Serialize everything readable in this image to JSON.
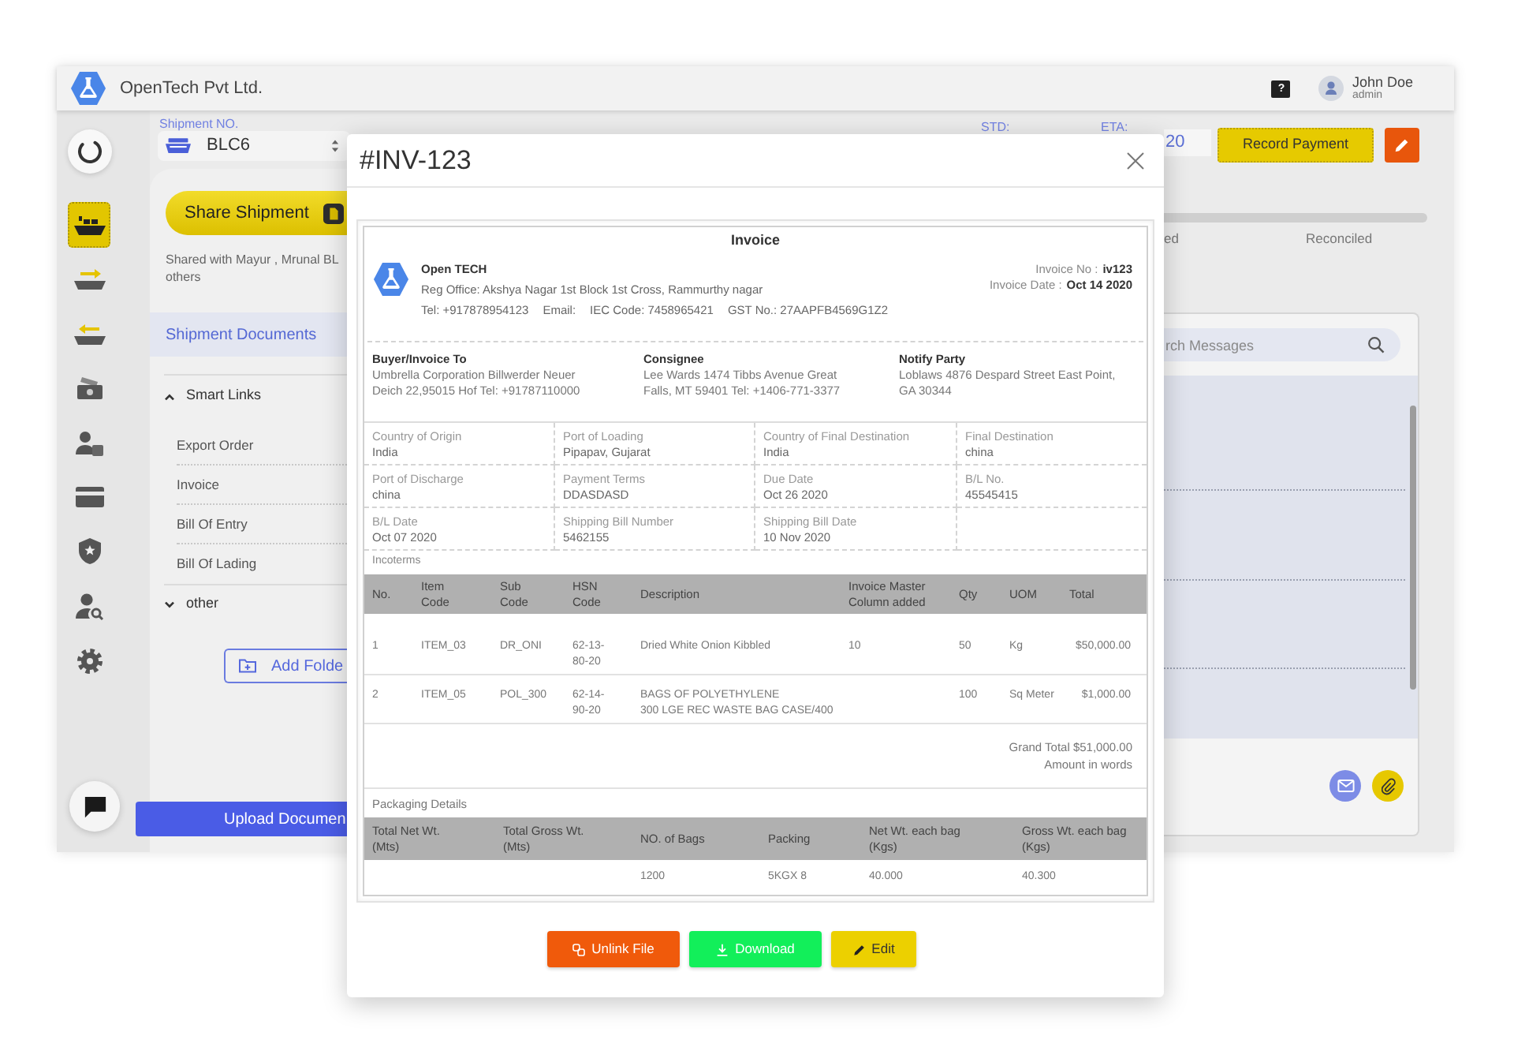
{
  "header": {
    "company": "OpenTech Pvt Ltd.",
    "help": "?",
    "user": {
      "name": "John Doe",
      "role": "admin"
    }
  },
  "sidebar": {
    "items": [
      {
        "kind": "ship",
        "selected": true
      },
      {
        "kind": "ship-export",
        "selected": false
      },
      {
        "kind": "ship-import",
        "selected": false
      },
      {
        "kind": "money",
        "selected": false
      },
      {
        "kind": "user-document",
        "selected": false
      },
      {
        "kind": "card",
        "selected": false
      },
      {
        "kind": "shield",
        "selected": false
      },
      {
        "kind": "user-search",
        "selected": false
      },
      {
        "kind": "settings",
        "selected": false
      }
    ]
  },
  "toolbar": {
    "shipment_label": "Shipment NO.",
    "shipment_value": "BLC6",
    "std_label": "STD:",
    "eta_label": "ETA:",
    "eta_value": "20",
    "record_payment": "Record Payment"
  },
  "share": {
    "button": "Share Shipment",
    "shared_with": [
      "Shared with Mayur , Mrunal BL",
      "others"
    ]
  },
  "progress": {
    "stages": [
      "ed",
      "Reconciled"
    ]
  },
  "documents": {
    "title": "Shipment Documents",
    "folders": [
      {
        "name": "Smart Links",
        "expanded": true,
        "files": [
          "Export Order",
          "Invoice",
          "Bill Of Entry",
          "Bill Of Lading"
        ]
      },
      {
        "name": "other",
        "expanded": false
      }
    ],
    "add_folder": "Add Folde",
    "upload": "Upload Documen"
  },
  "messages": {
    "search_placeholder": "rch Messages"
  },
  "modal": {
    "title": "#INV-123",
    "invoice": {
      "heading": "Invoice",
      "company": {
        "name": "Open TECH",
        "address": "Reg Office: Akshya Nagar 1st Block 1st Cross, Rammurthy nagar",
        "contacts": [
          "Tel: +917878954123",
          "Email:",
          "IEC Code: 7458965421",
          "GST No.: 27AAPFB4569G1Z2"
        ]
      },
      "meta": [
        {
          "label": "Invoice No :",
          "value": "iv123"
        },
        {
          "label": "Invoice Date :",
          "value": "Oct 14 2020"
        }
      ],
      "parties": [
        {
          "title": "Buyer/Invoice To",
          "lines": [
            "Umbrella Corporation Billwerder Neuer",
            "Deich 22,95015 Hof Tel: +91787110000"
          ]
        },
        {
          "title": "Consignee",
          "lines": [
            "Lee Wards 1474 Tibbs Avenue Great",
            "Falls, MT 59401 Tel: +1406-771-3377"
          ]
        },
        {
          "title": "Notify Party",
          "lines": [
            "Loblaws 4876 Despard Street East Point,",
            "GA 30344"
          ]
        }
      ],
      "details": [
        {
          "label": "Country of Origin",
          "value": "India"
        },
        {
          "label": "Port of Loading",
          "value": "Pipapav, Gujarat"
        },
        {
          "label": "Country of Final Destination",
          "value": "India"
        },
        {
          "label": "Final Destination",
          "value": "china"
        },
        {
          "label": "Port of Discharge",
          "value": "china"
        },
        {
          "label": "Payment Terms",
          "value": "DDASDASD"
        },
        {
          "label": "Due Date",
          "value": "Oct 26 2020"
        },
        {
          "label": "B/L No.",
          "value": "45545415"
        },
        {
          "label": "B/L Date",
          "value": "Oct 07 2020"
        },
        {
          "label": "Shipping Bill Number",
          "value": "5462155"
        },
        {
          "label": "Shipping Bill Date",
          "value": "10 Nov 2020"
        }
      ],
      "incoterms": "Incoterms",
      "items": {
        "columns": [
          "No.",
          "Item Code",
          "Sub Code",
          "HSN Code",
          "Description",
          "Invoice Master Column added",
          "Qty",
          "UOM",
          "Total"
        ],
        "rows": [
          [
            "1",
            "ITEM_03",
            "DR_ONI",
            "62-13-80-20",
            "Dried White Onion Kibbled",
            "10",
            "50",
            "Kg",
            "$50,000.00"
          ],
          [
            "2",
            "ITEM_05",
            "POL_300",
            "62-14-90-20",
            "BAGS OF POLYETHYLENE\n300 LGE REC WASTE BAG CASE/400",
            null,
            "100",
            "Sq Meter",
            "$1,000.00"
          ]
        ]
      },
      "grand_total": "Grand Total $51,000.00",
      "amount_in_words": "Amount in words",
      "packaging_title": "Packaging Details",
      "packaging": {
        "columns": [
          "Total Net Wt. (Mts)",
          "Total Gross Wt. (Mts)",
          "NO. of Bags",
          "Packing",
          "Net Wt. each bag (Kgs)",
          "Gross Wt. each bag (Kgs)"
        ],
        "rows": [
          [
            null,
            null,
            "1200",
            "5KGX 8",
            "40.000",
            "40.300"
          ]
        ]
      }
    },
    "actions": [
      {
        "kind": "unlink",
        "label": "Unlink File"
      },
      {
        "kind": "download",
        "label": "Download"
      },
      {
        "kind": "edit",
        "label": "Edit"
      }
    ]
  }
}
